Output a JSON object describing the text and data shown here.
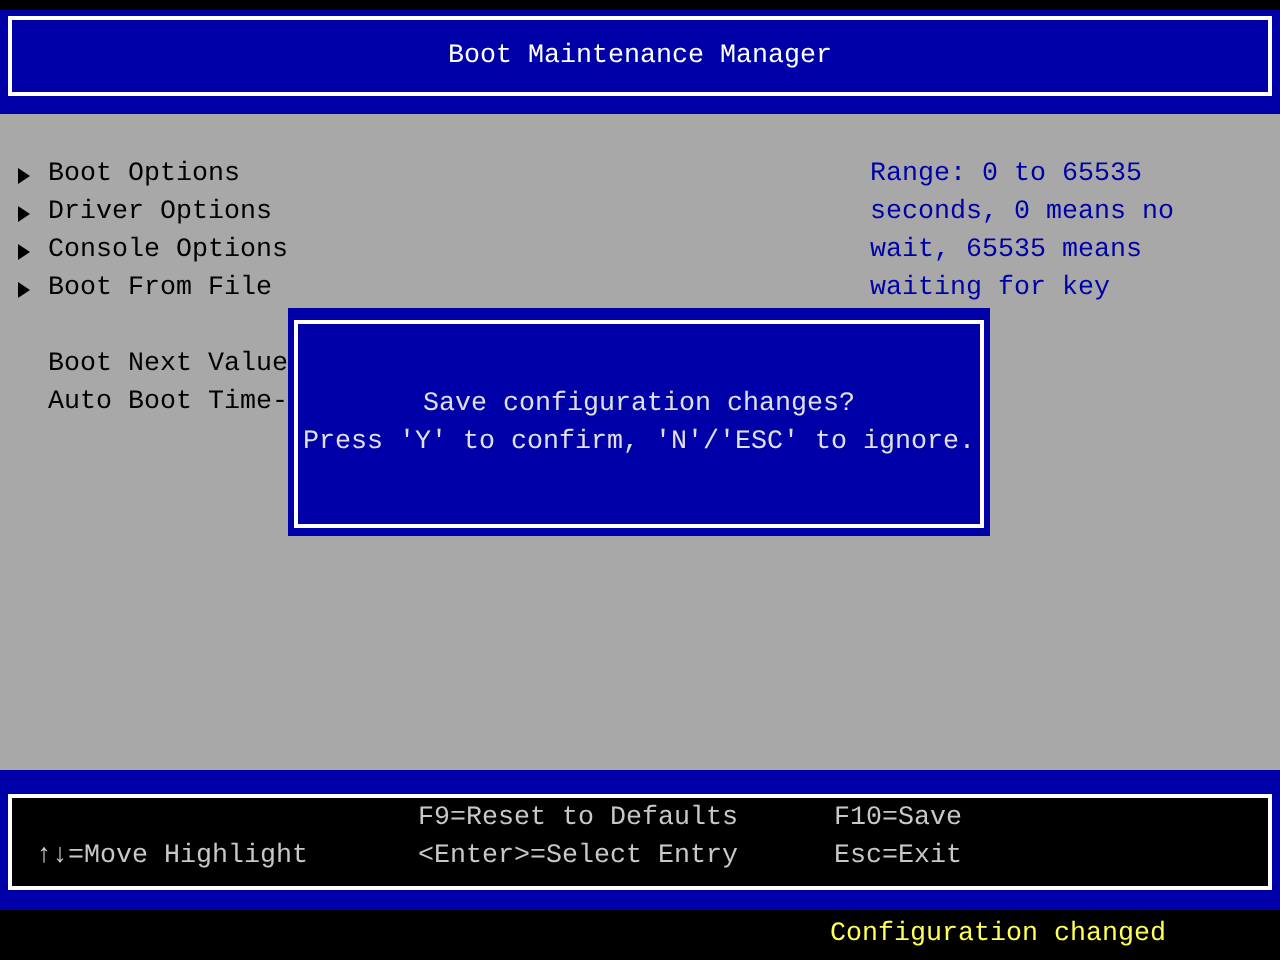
{
  "header": {
    "title": "Boot Maintenance Manager"
  },
  "menu": [
    {
      "kind": "submenu",
      "label": "Boot Options"
    },
    {
      "kind": "submenu",
      "label": "Driver Options"
    },
    {
      "kind": "submenu",
      "label": "Console Options"
    },
    {
      "kind": "submenu",
      "label": "Boot From File"
    },
    {
      "kind": "setting",
      "label": "Boot Next Value"
    },
    {
      "kind": "setting",
      "label": "Auto Boot Time-"
    }
  ],
  "help": {
    "text": "Range: 0 to 65535 seconds, 0 means no wait, 65535 means waiting for key"
  },
  "dialog": {
    "lines": [
      "Save configuration changes?",
      "Press 'Y' to confirm, 'N'/'ESC' to ignore."
    ]
  },
  "footer": {
    "columns": [
      {
        "lines": [
          "↑↓=Move Highlight"
        ]
      },
      {
        "lines": [
          "F9=Reset to Defaults",
          "<Enter>=Select Entry"
        ]
      },
      {
        "lines": [
          "F10=Save",
          "Esc=Exit"
        ]
      }
    ]
  },
  "status": {
    "text": "Configuration changed"
  }
}
